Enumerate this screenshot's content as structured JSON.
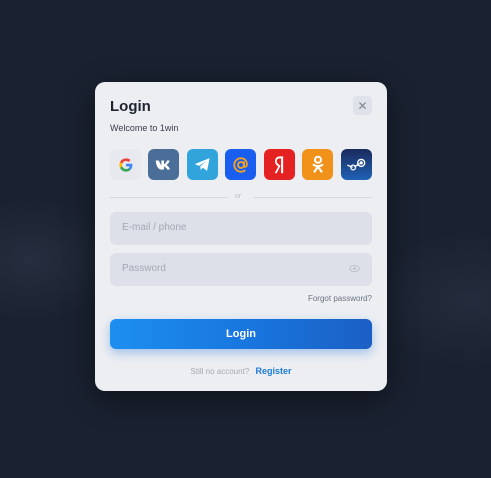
{
  "dialog": {
    "title": "Login",
    "subtitle": "Welcome to 1win",
    "close_icon": "close-icon"
  },
  "social": [
    {
      "name": "google",
      "icon": "google-icon",
      "bg": "#e7e9ee"
    },
    {
      "name": "vk",
      "icon": "vk-icon",
      "bg": "#4a6e97"
    },
    {
      "name": "telegram",
      "icon": "telegram-icon",
      "bg": "#31a4dc"
    },
    {
      "name": "mailru",
      "icon": "mailru-icon",
      "bg": "#1a5ef0"
    },
    {
      "name": "yandex",
      "icon": "yandex-icon",
      "bg": "#e52222"
    },
    {
      "name": "odnoklassniki",
      "icon": "odnoklassniki-icon",
      "bg": "#f0921a"
    },
    {
      "name": "steam",
      "icon": "steam-icon",
      "bg": "#1c3f80"
    }
  ],
  "divider": {
    "text": "or"
  },
  "form": {
    "email_placeholder": "E-mail / phone",
    "password_placeholder": "Password",
    "forgot_label": "Forgot password?",
    "login_label": "Login"
  },
  "footer": {
    "prompt": "Still no account?",
    "register_label": "Register"
  },
  "colors": {
    "accent": "#1b78e0",
    "background": "#1b2230",
    "modal": "#eceef2"
  }
}
